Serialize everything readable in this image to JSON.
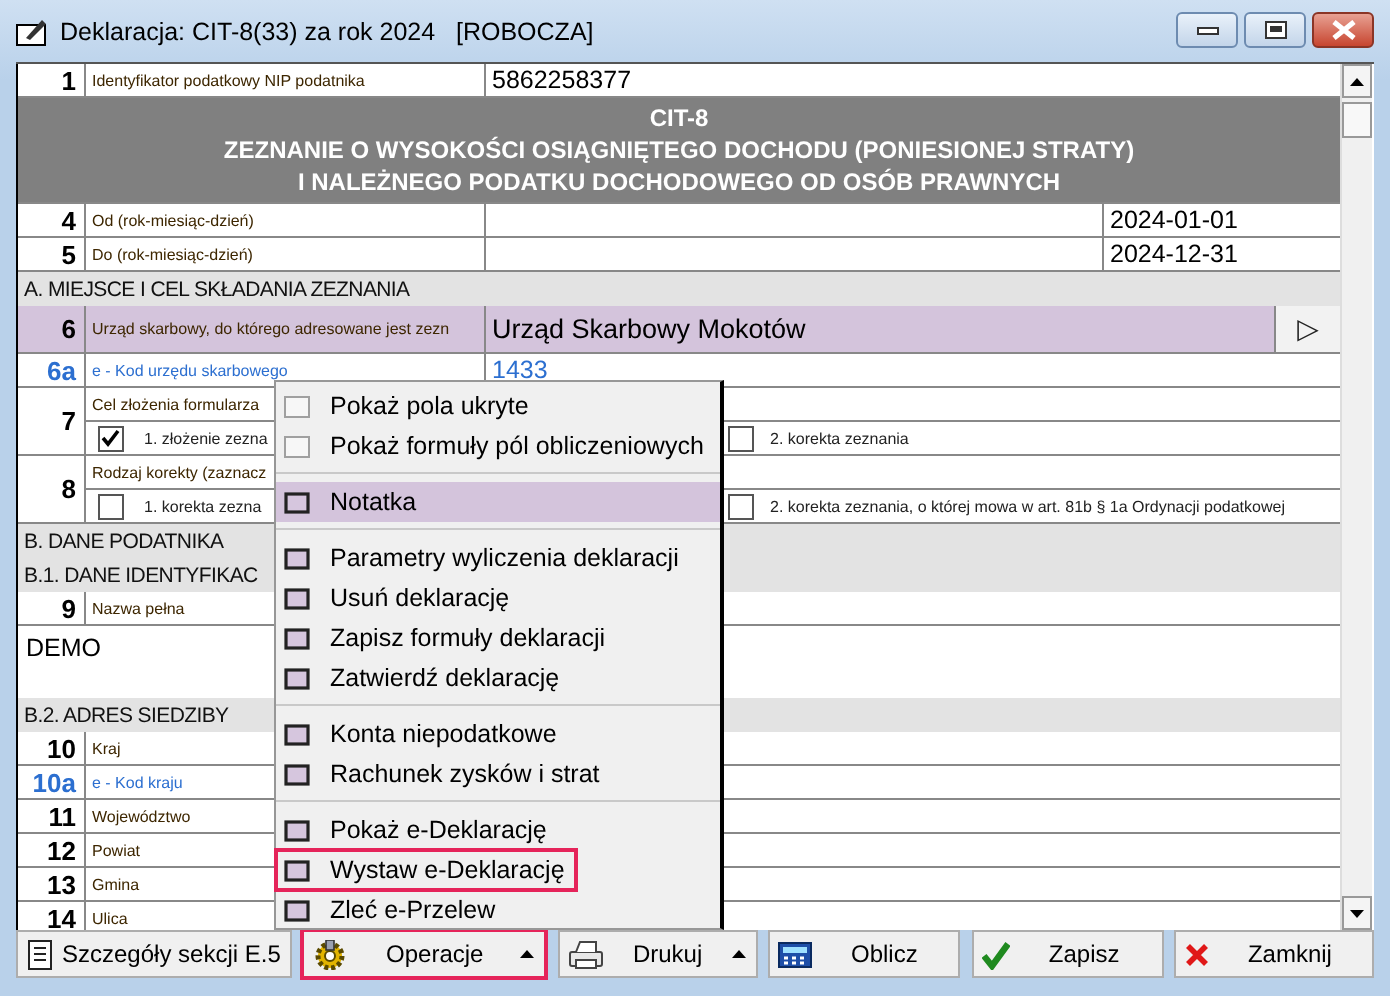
{
  "window": {
    "title": "Deklaracja: CIT-8(33) za rok 2024   [ROBOCZA]"
  },
  "form": {
    "rows": [
      {
        "kind": "field",
        "number": "1",
        "label": "Identyfikator podatkowy NIP podatnika",
        "value": "5862258377",
        "electronic": false
      },
      {
        "kind": "title",
        "lines": [
          "CIT-8",
          "ZEZNANIE O WYSOKOŚCI OSIĄGNIĘTEGO DOCHODU (PONIESIONEJ STRATY)",
          "I NALEŻNEGO PODATKU DOCHODOWEGO OD OSÓB PRAWNYCH"
        ]
      },
      {
        "kind": "date",
        "number": "4",
        "label": "Od (rok-miesiąc-dzień)",
        "value": "2024-01-01"
      },
      {
        "kind": "date",
        "number": "5",
        "label": "Do (rok-miesiąc-dzień)",
        "value": "2024-12-31"
      },
      {
        "kind": "section",
        "label": "A. MIEJSCE I CEL SKŁADANIA ZEZNANIA"
      },
      {
        "kind": "select",
        "number": "6",
        "label": "Urząd skarbowy, do którego adresowane jest zezn",
        "value": "Urząd Skarbowy Mokotów",
        "button": "▷"
      },
      {
        "kind": "field",
        "number": "6a",
        "label": "e - Kod urzędu skarbowego",
        "value": "1433",
        "electronic": true
      },
      {
        "kind": "checks",
        "number": "7",
        "label": "Cel złożenia formularza",
        "options": [
          {
            "label": "1. złożenie zezna",
            "checked": true
          },
          {
            "label": "2. korekta zeznania",
            "checked": false
          }
        ]
      },
      {
        "kind": "checks",
        "number": "8",
        "label": "Rodzaj korekty (zaznacz",
        "options": [
          {
            "label": "1. korekta zezna",
            "checked": false
          },
          {
            "label": "2.  korekta zeznania, o której mowa w art. 81b § 1a Ordynacji podatkowej",
            "checked": false
          }
        ]
      },
      {
        "kind": "section",
        "label": "B. DANE PODATNIKA"
      },
      {
        "kind": "section",
        "label": "B.1. DANE IDENTYFIKAC"
      },
      {
        "kind": "field",
        "number": "9",
        "label": "Nazwa pełna",
        "electronic": false
      },
      {
        "kind": "text",
        "value": "DEMO"
      },
      {
        "kind": "section",
        "label": "B.2. ADRES SIEDZIBY"
      },
      {
        "kind": "field",
        "number": "10",
        "label": "Kraj",
        "electronic": false
      },
      {
        "kind": "field",
        "number": "10a",
        "label": "e - Kod kraju",
        "electronic": true
      },
      {
        "kind": "field",
        "number": "11",
        "label": "Województwo",
        "electronic": false
      },
      {
        "kind": "field",
        "number": "12",
        "label": "Powiat",
        "electronic": false
      },
      {
        "kind": "field",
        "number": "13",
        "label": "Gmina",
        "electronic": false
      },
      {
        "kind": "field",
        "number": "14",
        "label": "Ulica",
        "electronic": false
      }
    ]
  },
  "menu": {
    "groups": [
      [
        {
          "label": "Pokaż pola ukryte",
          "kind": "option",
          "selected": false,
          "highlighted": false
        },
        {
          "label": "Pokaż formuły pól obliczeniowych",
          "kind": "option",
          "selected": false,
          "highlighted": false
        }
      ],
      [
        {
          "label": "Notatka",
          "kind": "command",
          "selected": true,
          "highlighted": false
        }
      ],
      [
        {
          "label": "Parametry wyliczenia deklaracji",
          "kind": "command",
          "selected": false,
          "highlighted": false
        },
        {
          "label": "Usuń deklarację",
          "kind": "command",
          "selected": false,
          "highlighted": false
        },
        {
          "label": "Zapisz formuły deklaracji",
          "kind": "command",
          "selected": false,
          "highlighted": false
        },
        {
          "label": "Zatwierdź deklarację",
          "kind": "command",
          "selected": false,
          "highlighted": false
        }
      ],
      [
        {
          "label": "Konta niepodatkowe",
          "kind": "command",
          "selected": false,
          "highlighted": false
        },
        {
          "label": "Rachunek zysków i strat",
          "kind": "command",
          "selected": false,
          "highlighted": false
        }
      ],
      [
        {
          "label": "Pokaż e-Deklarację",
          "kind": "command",
          "selected": false,
          "highlighted": false
        },
        {
          "label": "Wystaw e-Deklarację",
          "kind": "command",
          "selected": false,
          "highlighted": true
        },
        {
          "label": "Zleć e-Przelew",
          "kind": "command",
          "selected": false,
          "highlighted": false
        }
      ]
    ]
  },
  "toolbar": {
    "buttons": [
      {
        "label": "Szczegóły sekcji E.5",
        "has_menu": false,
        "highlighted": false
      },
      {
        "label": "Operacje",
        "has_menu": true,
        "highlighted": true
      },
      {
        "label": "Drukuj",
        "has_menu": true,
        "highlighted": false
      },
      {
        "label": "Oblicz",
        "has_menu": false,
        "highlighted": false
      },
      {
        "label": "Zapisz",
        "has_menu": false,
        "highlighted": false
      },
      {
        "label": "Zamknij",
        "has_menu": false,
        "highlighted": false
      }
    ]
  }
}
